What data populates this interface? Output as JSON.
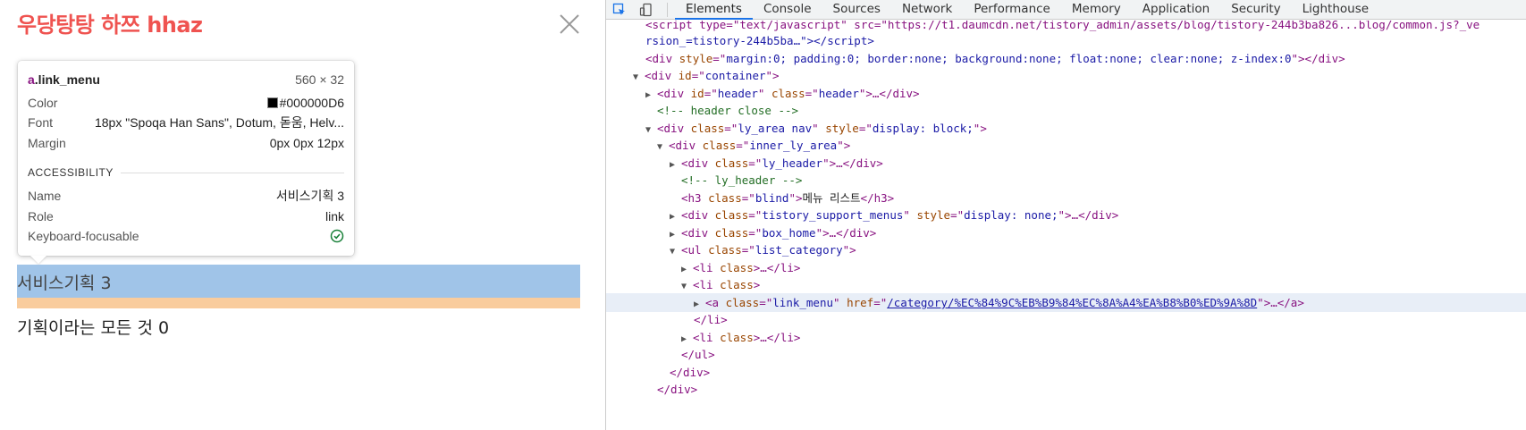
{
  "page": {
    "blog_title": "우당탕탕 하쯔 hhaz",
    "close_icon": "close-icon",
    "highlighted_link_text": "서비스기획 3",
    "next_item_text": "기획이라는 모든 것 0",
    "colors": {
      "title": "#ef5350",
      "highlight_content": "#a0c4e8",
      "highlight_margin": "#f9cc9d"
    }
  },
  "tooltip": {
    "selector_tag": "a",
    "selector_class": ".link_menu",
    "size": "560 × 32",
    "color_label": "Color",
    "color_value": "#000000D6",
    "font_label": "Font",
    "font_value": "18px \"Spoqa Han Sans\", Dotum, 돋움, Helv...",
    "margin_label": "Margin",
    "margin_value": "0px 0px 12px",
    "section_title": "ACCESSIBILITY",
    "name_label": "Name",
    "name_value": "서비스기획 3",
    "role_label": "Role",
    "role_value": "link",
    "keyboard_label": "Keyboard-focusable",
    "keyboard_icon": "check-circle-icon"
  },
  "devtools": {
    "tabs": [
      "Elements",
      "Console",
      "Sources",
      "Network",
      "Performance",
      "Memory",
      "Application",
      "Security",
      "Lighthouse"
    ],
    "active_tab": "Elements",
    "code": {
      "l0": "<script type=\"text/javascript\" src=\"https://t1.daumcdn.net/tistory_admin/assets/blog/tistory-244b3ba826...blog/common.js?_ve",
      "l1": "rsion_=tistory-244b5ba…\"></script>",
      "l2_tag": "div",
      "l2_style": "margin:0; padding:0; border:none; background:none; float:none; clear:none; z-index:0",
      "l3_id": "container",
      "l4_id": "header",
      "l4_class": "header",
      "l5_comment": "<!-- header close -->",
      "l6_class": "ly_area nav",
      "l6_style": "display: block;",
      "l7_class": "inner_ly_area",
      "l8_class": "ly_header",
      "l9_comment": "<!-- ly_header -->",
      "l10_class": "blind",
      "l10_text": "메뉴 리스트",
      "l11_class": "tistory_support_menus",
      "l11_style": "display: none;",
      "l12_class": "box_home",
      "l13_class": "list_category",
      "l14_class": "",
      "l15_class": "",
      "l16_class": "link_menu",
      "l16_href": "/category/%EC%84%9C%EB%B9%84%EC%8A%A4%EA%B8%B0%ED%9A%8D",
      "l17": "</li>",
      "l18_class": "",
      "l19": "</ul>",
      "l20": "</div>",
      "l21": "</div>"
    }
  }
}
